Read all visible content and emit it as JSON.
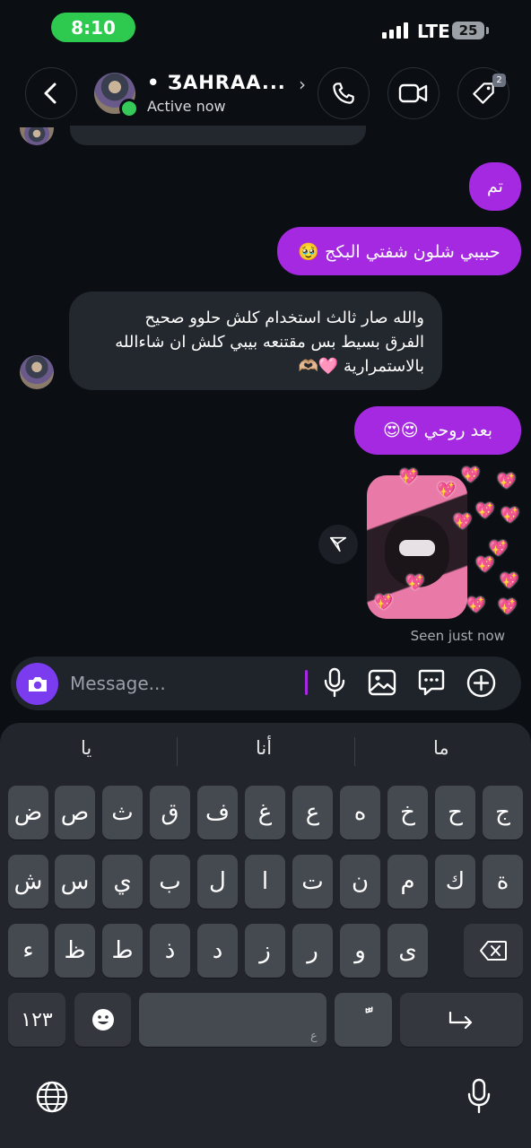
{
  "status_bar": {
    "time": "8:10",
    "network": "LTE",
    "battery": "25"
  },
  "header": {
    "contact_name": "• ƷAHRAA...",
    "status": "Active now",
    "tag_badge_count": "2",
    "icons": [
      "back-icon",
      "phone-icon",
      "video-icon",
      "tag-icon"
    ]
  },
  "messages": [
    {
      "direction": "outgoing",
      "text": "تم"
    },
    {
      "direction": "outgoing",
      "text": "حبيبي شلون شفتي البكج 🥹"
    },
    {
      "direction": "incoming",
      "lines": [
        "والله صار ثالث استخدام كلش حلوو صحيح",
        "الفرق بسيط بس مقتنعه بيبي كلش ان شاءالله",
        "بالاستمرارية 🩷🫶🏼"
      ]
    },
    {
      "direction": "outgoing",
      "text": "بعد روحي 😍😍"
    },
    {
      "direction": "outgoing",
      "type": "sticker",
      "description": "sticker"
    }
  ],
  "seen_text": "Seen just now",
  "composer": {
    "placeholder": "Message...",
    "icons": [
      "camera-icon",
      "mic-icon",
      "gallery-icon",
      "sticker-icon",
      "plus-icon"
    ]
  },
  "keyboard": {
    "suggestions": [
      "ما",
      "أنا",
      "يا"
    ],
    "row1": [
      "ج",
      "ح",
      "خ",
      "ه",
      "ع",
      "غ",
      "ف",
      "ق",
      "ث",
      "ص",
      "ض"
    ],
    "row2": [
      "ة",
      "ك",
      "م",
      "ن",
      "ت",
      "ا",
      "ل",
      "ب",
      "ي",
      "س",
      "ش"
    ],
    "row3": [
      "ى",
      "و",
      "ر",
      "ز",
      "د",
      "ذ",
      "ط",
      "ظ",
      "ء"
    ],
    "numbers_key": "١٢٣",
    "space_hint": "ع",
    "diacritic_key": "ًّ",
    "icons": [
      "backspace-icon",
      "emoji-icon",
      "return-icon",
      "globe-icon",
      "dictation-icon"
    ]
  }
}
